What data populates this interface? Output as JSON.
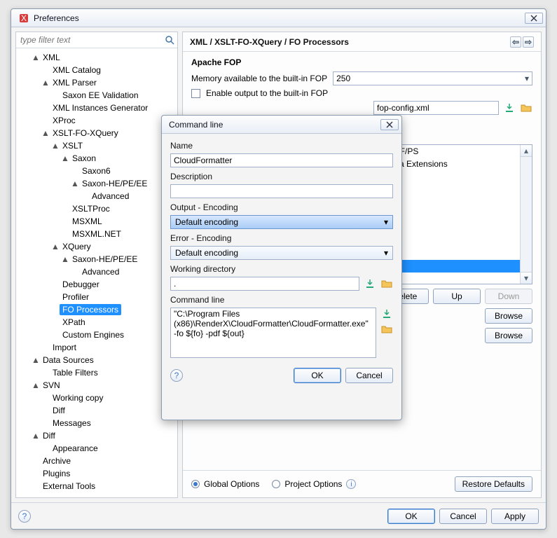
{
  "window": {
    "title": "Preferences"
  },
  "filter": {
    "placeholder": "type filter text"
  },
  "tree": [
    {
      "d": 1,
      "exp": "▲",
      "label": "XML"
    },
    {
      "d": 2,
      "exp": "",
      "label": "XML Catalog"
    },
    {
      "d": 2,
      "exp": "▲",
      "label": "XML Parser"
    },
    {
      "d": 3,
      "exp": "",
      "label": "Saxon EE Validation"
    },
    {
      "d": 2,
      "exp": "",
      "label": "XML Instances Generator"
    },
    {
      "d": 2,
      "exp": "",
      "label": "XProc"
    },
    {
      "d": 2,
      "exp": "▲",
      "label": "XSLT-FO-XQuery"
    },
    {
      "d": 3,
      "exp": "▲",
      "label": "XSLT"
    },
    {
      "d": 4,
      "exp": "▲",
      "label": "Saxon"
    },
    {
      "d": 5,
      "exp": "",
      "label": "Saxon6"
    },
    {
      "d": 5,
      "exp": "▲",
      "label": "Saxon-HE/PE/EE"
    },
    {
      "d": 6,
      "exp": "",
      "label": "Advanced"
    },
    {
      "d": 4,
      "exp": "",
      "label": "XSLTProc"
    },
    {
      "d": 4,
      "exp": "",
      "label": "MSXML"
    },
    {
      "d": 4,
      "exp": "",
      "label": "MSXML.NET"
    },
    {
      "d": 3,
      "exp": "▲",
      "label": "XQuery"
    },
    {
      "d": 4,
      "exp": "▲",
      "label": "Saxon-HE/PE/EE"
    },
    {
      "d": 5,
      "exp": "",
      "label": "Advanced"
    },
    {
      "d": 3,
      "exp": "",
      "label": "Debugger"
    },
    {
      "d": 3,
      "exp": "",
      "label": "Profiler"
    },
    {
      "d": 3,
      "exp": "",
      "label": "FO Processors",
      "selected": true
    },
    {
      "d": 3,
      "exp": "",
      "label": "XPath"
    },
    {
      "d": 3,
      "exp": "",
      "label": "Custom Engines"
    },
    {
      "d": 2,
      "exp": "",
      "label": "Import"
    },
    {
      "d": 1,
      "exp": "▲",
      "label": "Data Sources"
    },
    {
      "d": 2,
      "exp": "",
      "label": "Table Filters"
    },
    {
      "d": 1,
      "exp": "▲",
      "label": "SVN"
    },
    {
      "d": 2,
      "exp": "",
      "label": "Working copy"
    },
    {
      "d": 2,
      "exp": "",
      "label": "Diff"
    },
    {
      "d": 2,
      "exp": "",
      "label": "Messages"
    },
    {
      "d": 1,
      "exp": "▲",
      "label": "Diff"
    },
    {
      "d": 2,
      "exp": "",
      "label": "Appearance"
    },
    {
      "d": 1,
      "exp": "",
      "label": "Archive"
    },
    {
      "d": 1,
      "exp": "",
      "label": "Plugins"
    },
    {
      "d": 1,
      "exp": "",
      "label": "External Tools"
    }
  ],
  "breadcrumb": "XML / XSLT-FO-XQuery / FO Processors",
  "apache": {
    "heading": "Apache FOP",
    "mem_label": "Memory available to the built-in FOP",
    "mem_value": "250",
    "enable_label": "Enable output to the built-in FOP",
    "config_value": "fop-config.xml"
  },
  "processors": {
    "items": [
      "PDF/PS",
      "edia Extensions"
    ],
    "buttons": {
      "delete": "Delete",
      "up": "Up",
      "down": "Down",
      "browse": "Browse"
    }
  },
  "scope": {
    "global": "Global Options",
    "project": "Project Options",
    "restore": "Restore Defaults"
  },
  "footer": {
    "ok": "OK",
    "cancel": "Cancel",
    "apply": "Apply"
  },
  "dialog": {
    "title": "Command line",
    "name_label": "Name",
    "name_value": "CloudFormatter",
    "desc_label": "Description",
    "desc_value": "",
    "out_enc_label": "Output - Encoding",
    "out_enc_value": "Default encoding",
    "err_enc_label": "Error - Encoding",
    "err_enc_value": "Default encoding",
    "wd_label": "Working directory",
    "wd_value": ".",
    "cmd_label": "Command line",
    "cmd_value": "\"C:\\Program Files (x86)\\RenderX\\CloudFormatter\\CloudFormatter.exe\" -fo ${fo} -pdf ${out}",
    "ok": "OK",
    "cancel": "Cancel"
  }
}
